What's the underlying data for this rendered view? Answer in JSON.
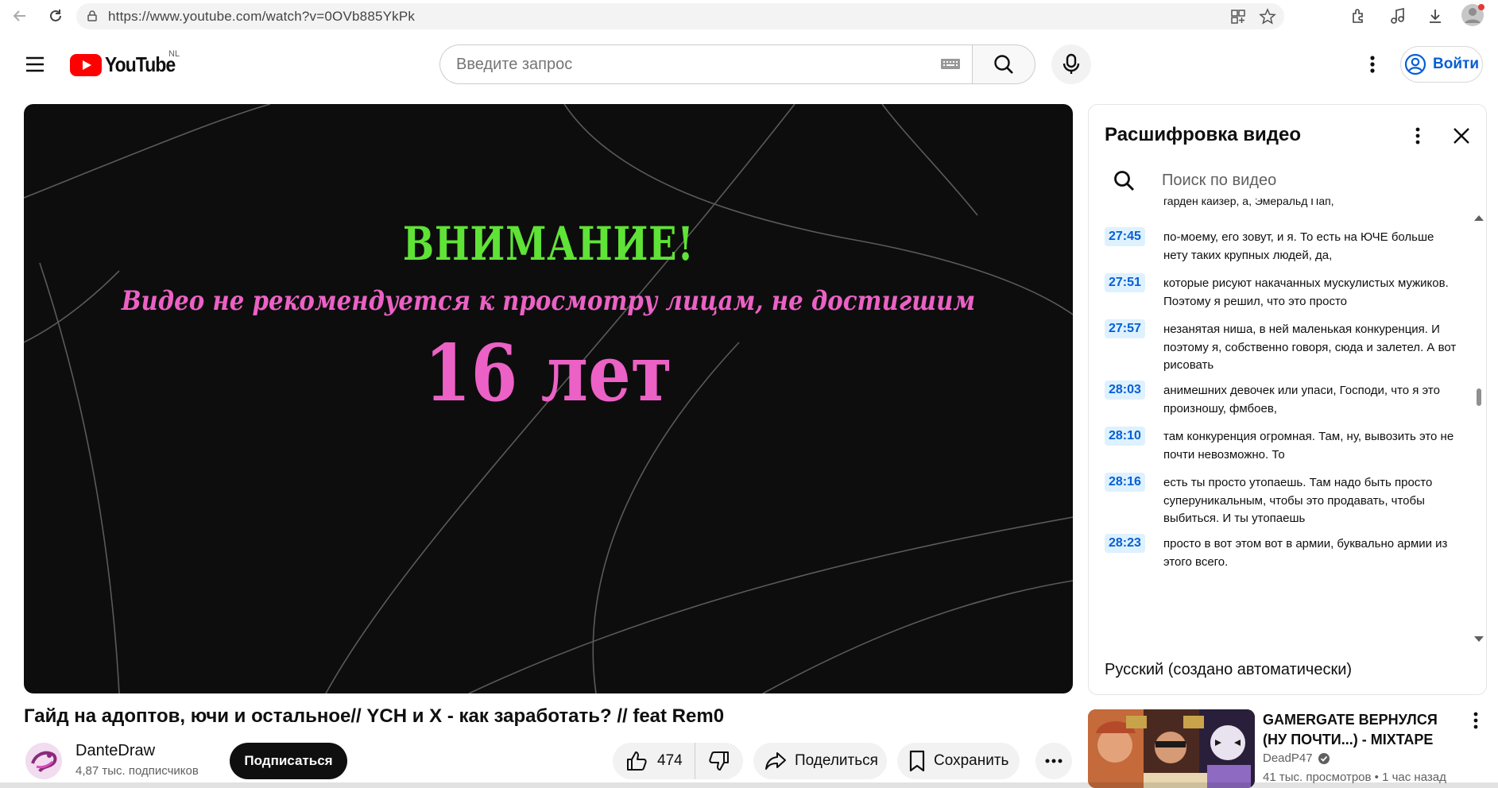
{
  "browser": {
    "url": "https://www.youtube.com/watch?v=0OVb885YkPk"
  },
  "header": {
    "logo_text": "YouTube",
    "region": "NL",
    "search_placeholder": "Введите запрос",
    "signin_label": "Войти"
  },
  "video": {
    "warning_title": "ВНИМАНИЕ!",
    "warning_subtitle": "Видео не рекомендуется к просмотру лицам, не достигшим",
    "warning_age": "16 лет"
  },
  "transcript": {
    "title": "Расшифровка видео",
    "search_placeholder": "Поиск по видео",
    "partial_line": "гарден кайзер, а, Эмеральд Пап,",
    "segments": [
      {
        "time": "27:45",
        "text": "по-моему, его зовут, и я. То есть на ЮЧЕ больше нету таких крупных людей, да,"
      },
      {
        "time": "27:51",
        "text": "которые рисуют накачанных мускулистых мужиков. Поэтому я решил, что это просто"
      },
      {
        "time": "27:57",
        "text": "незанятая ниша, в ней маленькая конкуренция. И поэтому я, собственно говоря, сюда и залетел. А вот рисовать"
      },
      {
        "time": "28:03",
        "text": "анимешних девочек или упаси, Господи, что я это произношу, фмбоев,"
      },
      {
        "time": "28:10",
        "text": "там конкуренция огромная. Там, ну, вывозить это не почти невозможно. То"
      },
      {
        "time": "28:16",
        "text": "есть ты просто утопаешь. Там надо быть просто суперуникальным, чтобы это продавать, чтобы выбиться. И ты утопаешь"
      },
      {
        "time": "28:23",
        "text": "просто в вот этом вот в армии, буквально армии из этого всего."
      }
    ],
    "language": "Русский (создано автоматически)"
  },
  "meta": {
    "title": "Гайд на адоптов, ючи и остальное// YCH и X - как заработать? // feat Rem0",
    "channel": "DanteDraw",
    "subscribers": "4,87 тыс. подписчиков",
    "subscribe_label": "Подписаться",
    "likes": "474",
    "share_label": "Поделиться",
    "save_label": "Сохранить"
  },
  "recommendation": {
    "title": "GAMERGATE ВЕРНУЛСЯ (НУ ПОЧТИ...) - MIXTAPE",
    "channel": "DeadP47",
    "views": "41 тыс. просмотров • 1 час назад"
  },
  "colors": {
    "yt_red": "#ff0000",
    "link_blue": "#065fd4",
    "warning_green": "#5fe336",
    "warning_pink": "#ec61c5"
  }
}
